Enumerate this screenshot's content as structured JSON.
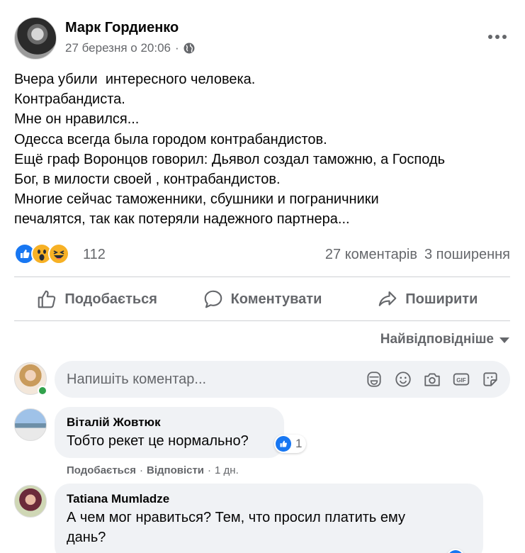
{
  "post": {
    "author": "Марк Гордиенко",
    "timestamp": "27 березня о 20:06",
    "audience_icon": "globe-icon",
    "body_lines": [
      "Вчера убили  интересного человека.",
      "Контрабандиста.",
      "Мне он нравился...",
      "Одесса всегда была городом контрабандистов.",
      "Ещё граф Воронцов говорил: Дьявол создал таможню, а Господь",
      "Бог, в милости своей , контрабандистов.",
      "Многие сейчас таможенники, сбушники и пограничники",
      "печалятся, так как потеряли надежного партнера..."
    ]
  },
  "engagement": {
    "reaction_count": "112",
    "comments_count": "27 коментарів",
    "shares_count": "3 поширення",
    "reaction_icons": [
      "like-reaction-icon",
      "wow-reaction-icon",
      "haha-reaction-icon"
    ]
  },
  "actions": {
    "like_label": "Подобається",
    "comment_label": "Коментувати",
    "share_label": "Поширити"
  },
  "sort": {
    "label": "Найвідповідніше"
  },
  "composer": {
    "placeholder": "Напишіть коментар...",
    "icons": [
      "avatar-sticker-icon",
      "emoji-icon",
      "camera-icon",
      "gif-icon",
      "sticker-icon"
    ]
  },
  "comments": [
    {
      "author": "Віталій Жовтюк",
      "text": "Тобто рекет це нормально?",
      "reaction_count": "1",
      "like_label": "Подобається",
      "reply_label": "Відповісти",
      "age": "1 дн."
    },
    {
      "author": "Tatiana Mumladze",
      "text": "А чем мог нравиться? Тем, что просил платить ему\nдань?"
    }
  ],
  "colors": {
    "brand_blue": "#1877f2",
    "secondary_text": "#65676b",
    "bubble_bg": "#f0f2f5",
    "online_green": "#31a24c"
  }
}
